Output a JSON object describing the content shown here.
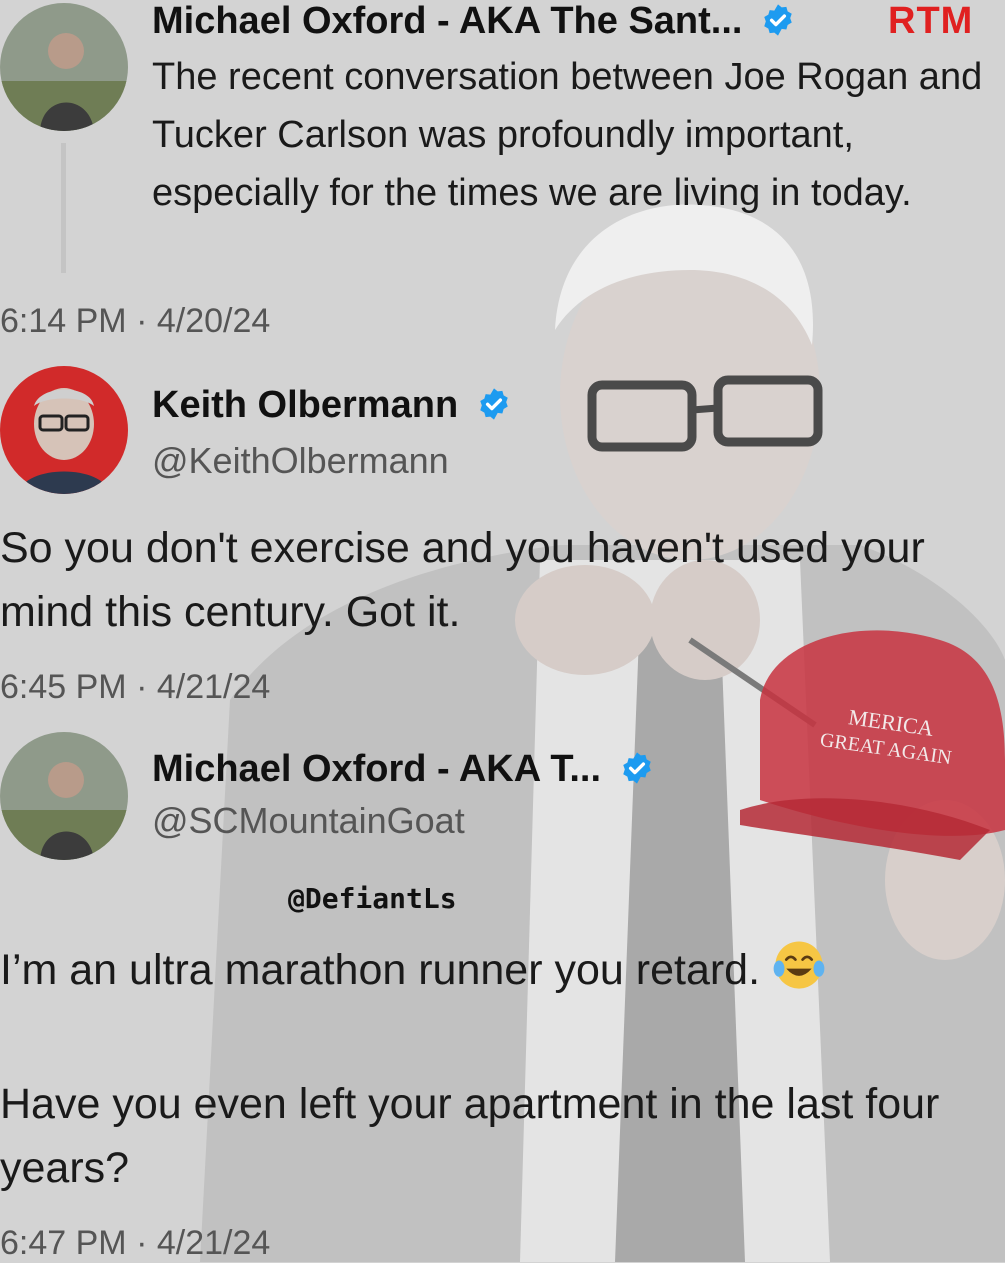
{
  "colors": {
    "background": "#d3d3d3",
    "verified_badge": "#1d9bf0",
    "brand_red": "#e02020",
    "cap_red": "#c8323f"
  },
  "tweet1": {
    "name": "Michael Oxford - AKA The Sant...",
    "verified_icon": "verified-badge-icon",
    "brand": "RTM",
    "text": "The recent conversation between Joe Rogan and Tucker Carlson was profoundly important, especially for the times we are living in today.",
    "timestamp": "6:14 PM · 4/20/24"
  },
  "tweet2": {
    "name": "Keith Olbermann",
    "verified_icon": "verified-badge-icon",
    "handle": "@KeithOlbermann",
    "text": "So you don't exercise and you haven't used your mind this century. Got it.",
    "timestamp": "6:45 PM · 4/21/24"
  },
  "tweet3": {
    "name": "Michael Oxford - AKA T...",
    "verified_icon": "verified-badge-icon",
    "handle": "@SCMountainGoat",
    "watermark": "@DefiantLs",
    "text1": "I’m an ultra marathon runner you retard.",
    "emoji": "tears-of-joy-emoji",
    "text2": "Have you even left your apartment in the last four years?",
    "timestamp": "6:47 PM · 4/21/24"
  },
  "cap": {
    "line1": "MERICA",
    "line2": "GREAT AGAIN"
  }
}
